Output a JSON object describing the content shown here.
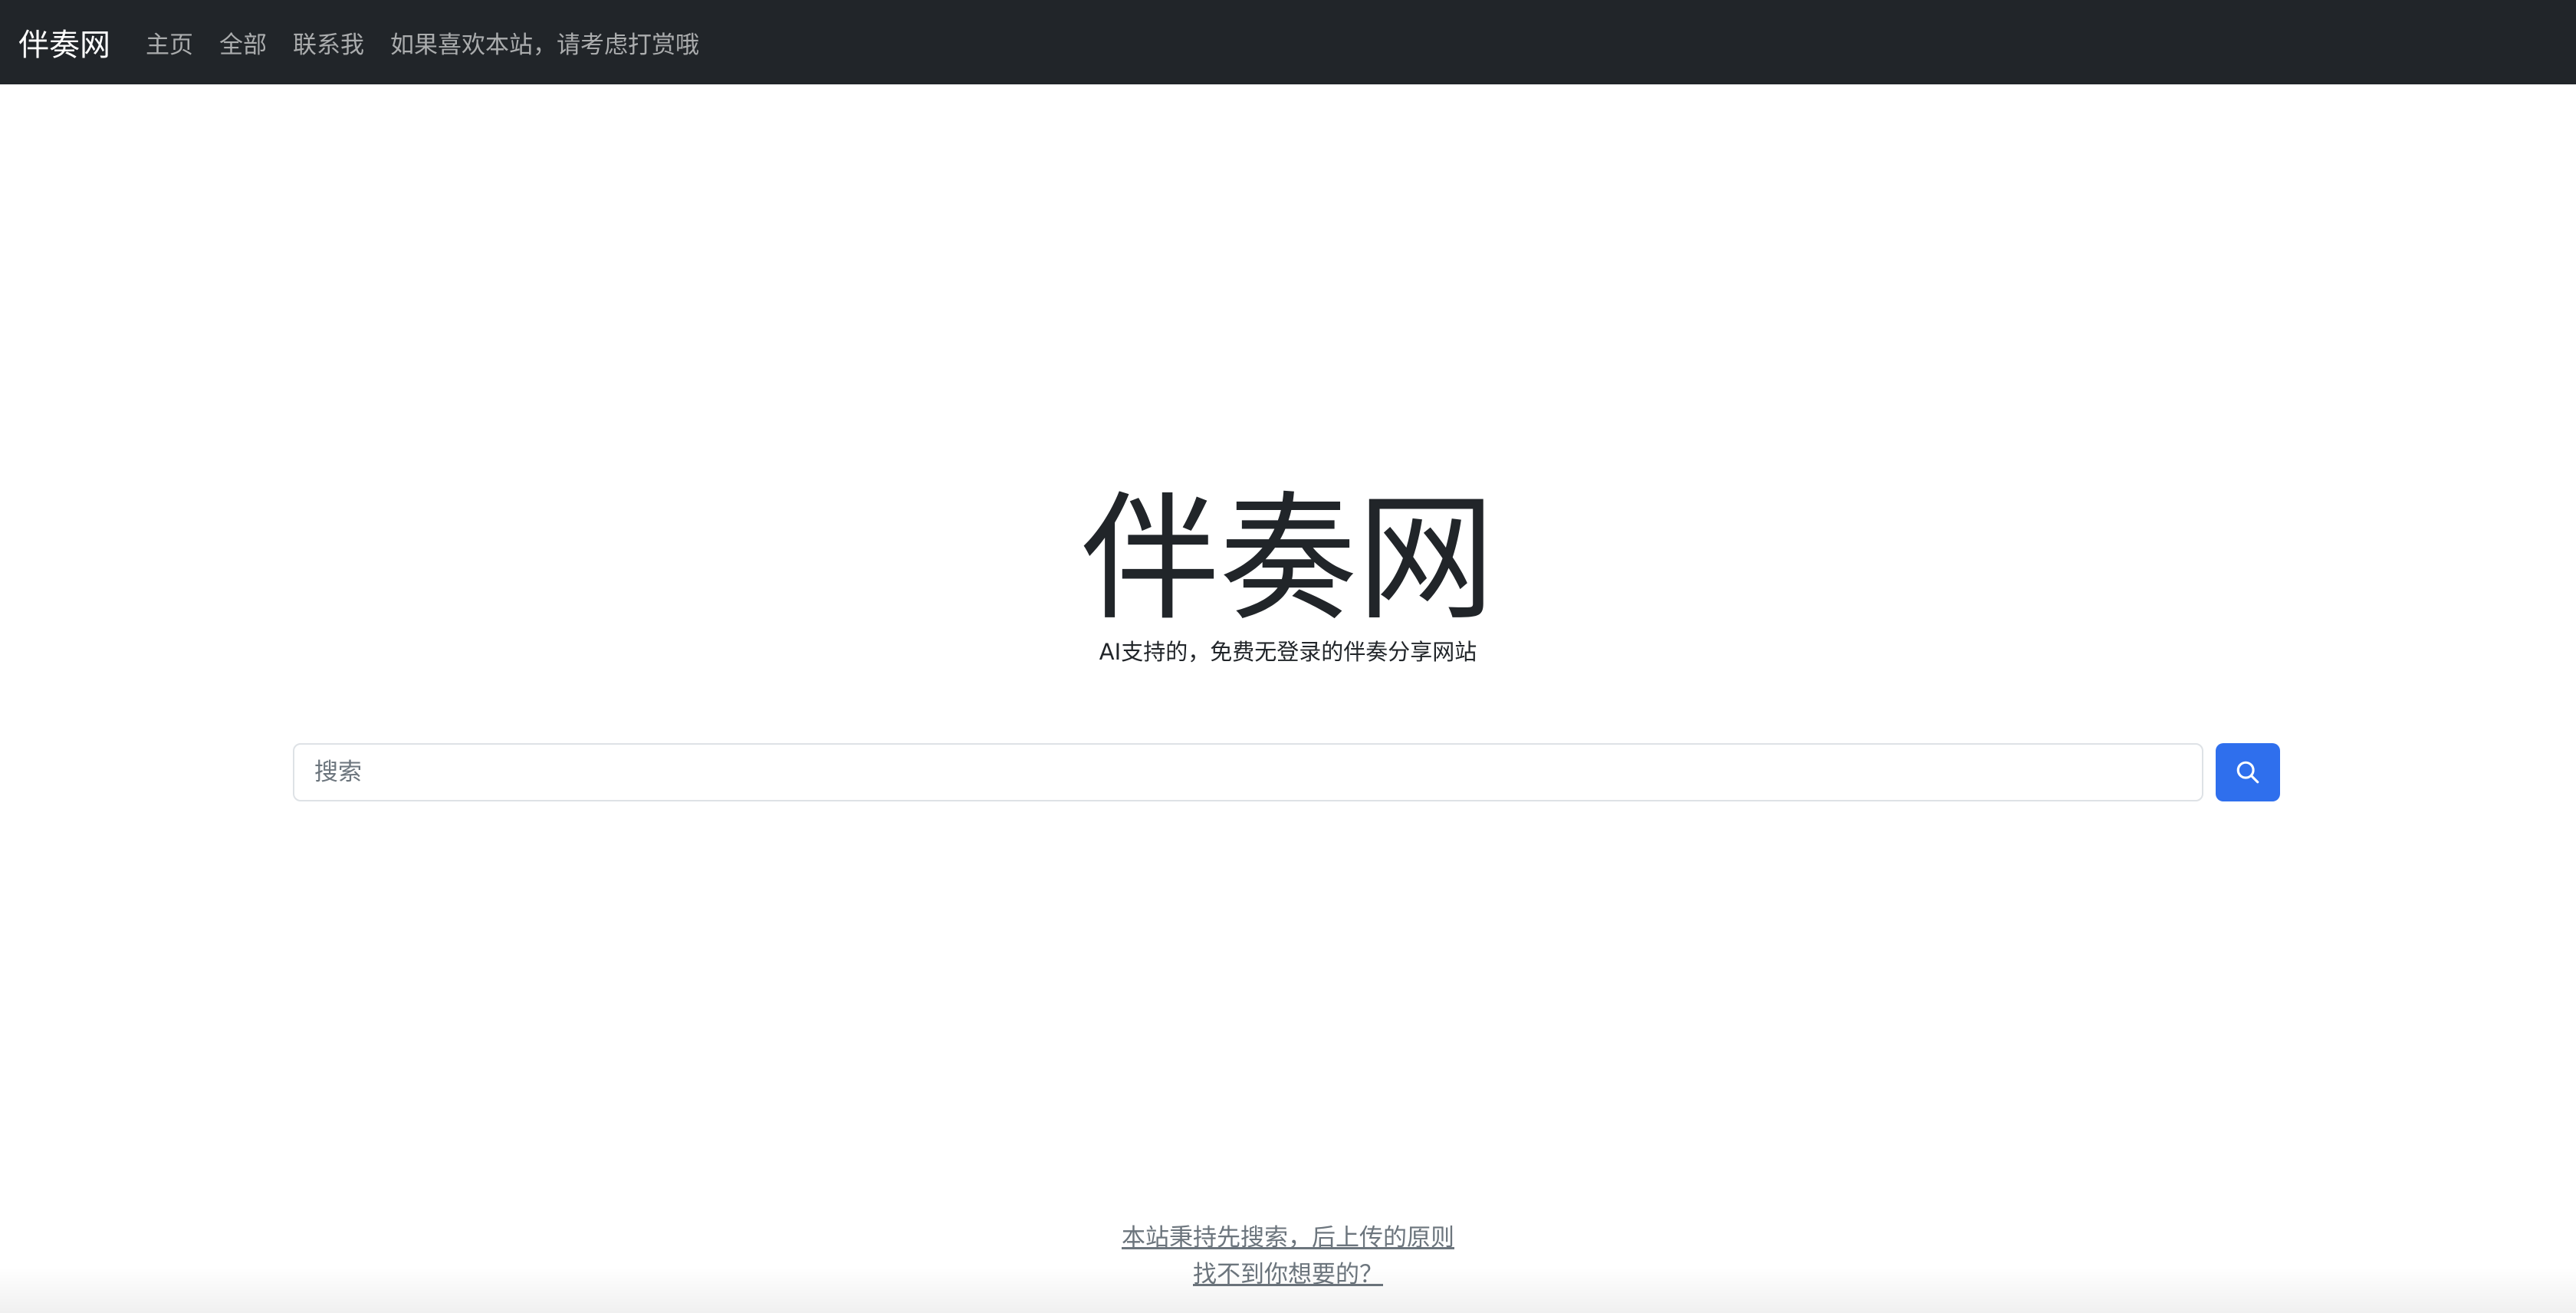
{
  "navbar": {
    "brand": "伴奏网",
    "links": [
      "主页",
      "全部",
      "联系我",
      "如果喜欢本站，请考虑打赏哦"
    ]
  },
  "hero": {
    "title": "伴奏网",
    "subtitle": "AI支持的，免费无登录的伴奏分享网站"
  },
  "search": {
    "placeholder": "搜索",
    "button_icon": "search-icon"
  },
  "footer": {
    "principle_link": "本站秉持先搜索，后上传的原则",
    "not_found_link": "找不到你想要的？"
  },
  "colors": {
    "navbar_bg": "#212529",
    "accent": "#2f6fed",
    "muted": "#6c757d"
  }
}
